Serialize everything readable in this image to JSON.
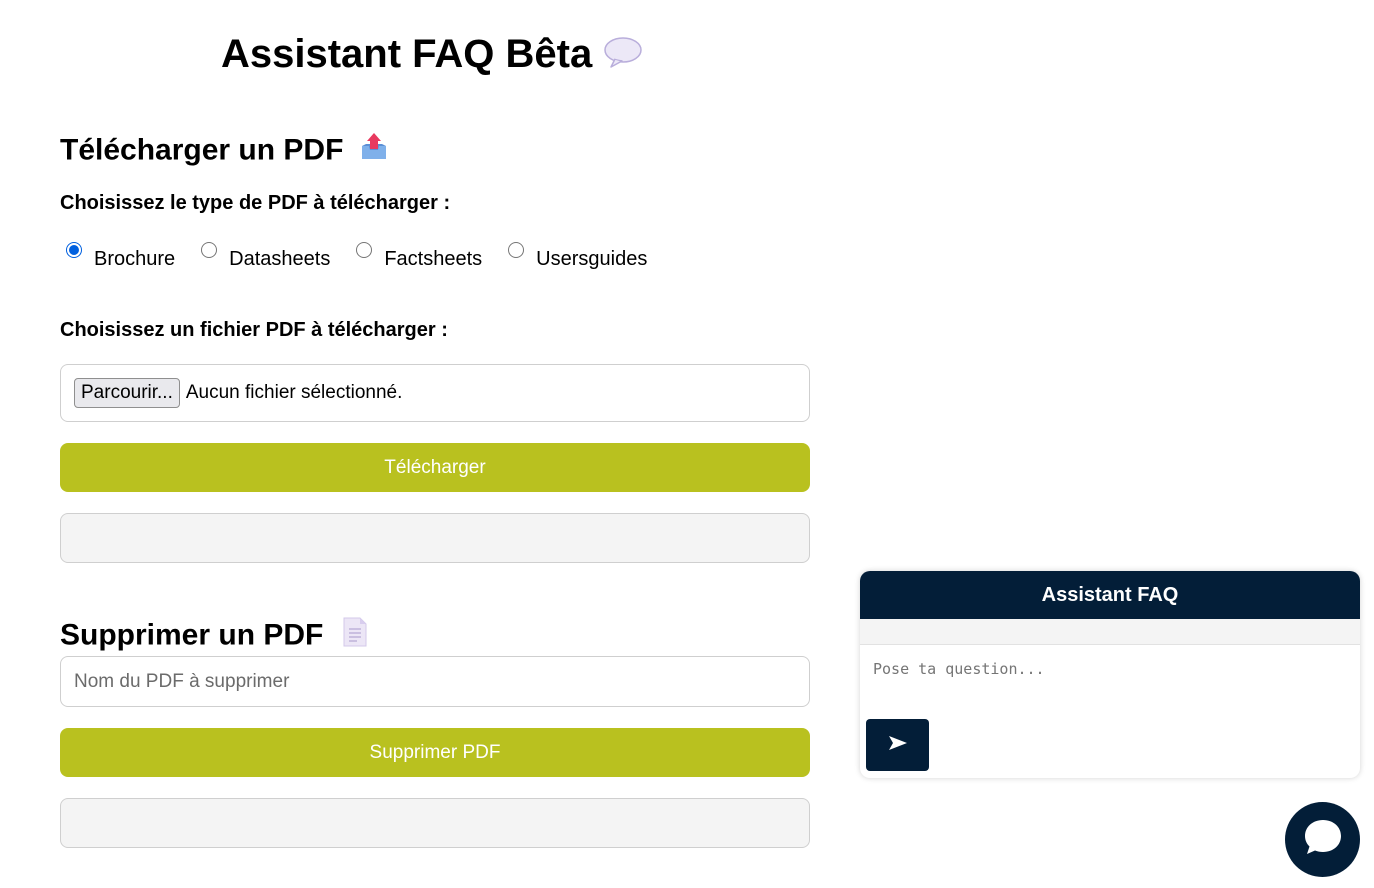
{
  "header": {
    "title": "Assistant FAQ Bêta",
    "title_icon": "speech-bubble-icon"
  },
  "upload": {
    "title": "Télécharger un PDF",
    "title_icon": "outbox-tray-icon",
    "type_label": "Choisissez le type de PDF à télécharger :",
    "types": [
      {
        "label": "Brochure",
        "checked": true
      },
      {
        "label": "Datasheets",
        "checked": false
      },
      {
        "label": "Factsheets",
        "checked": false
      },
      {
        "label": "Usersguides",
        "checked": false
      }
    ],
    "file_label": "Choisissez un fichier PDF à télécharger :",
    "browse_label": "Parcourir...",
    "file_status": "Aucun fichier sélectionné.",
    "submit_label": "Télécharger",
    "result_text": ""
  },
  "delete": {
    "title": "Supprimer un PDF",
    "title_icon": "page-icon",
    "name_placeholder": "Nom du PDF à supprimer",
    "submit_label": "Supprimer PDF",
    "result_text": ""
  },
  "chat": {
    "header": "Assistant FAQ",
    "input_placeholder": "Pose ta question...",
    "send_icon": "send-arrow-icon",
    "toggle_icon": "chat-bubble-icon"
  },
  "colors": {
    "accent_green": "#b9c11f",
    "navy": "#031e38",
    "radio_blue": "#0060df"
  }
}
